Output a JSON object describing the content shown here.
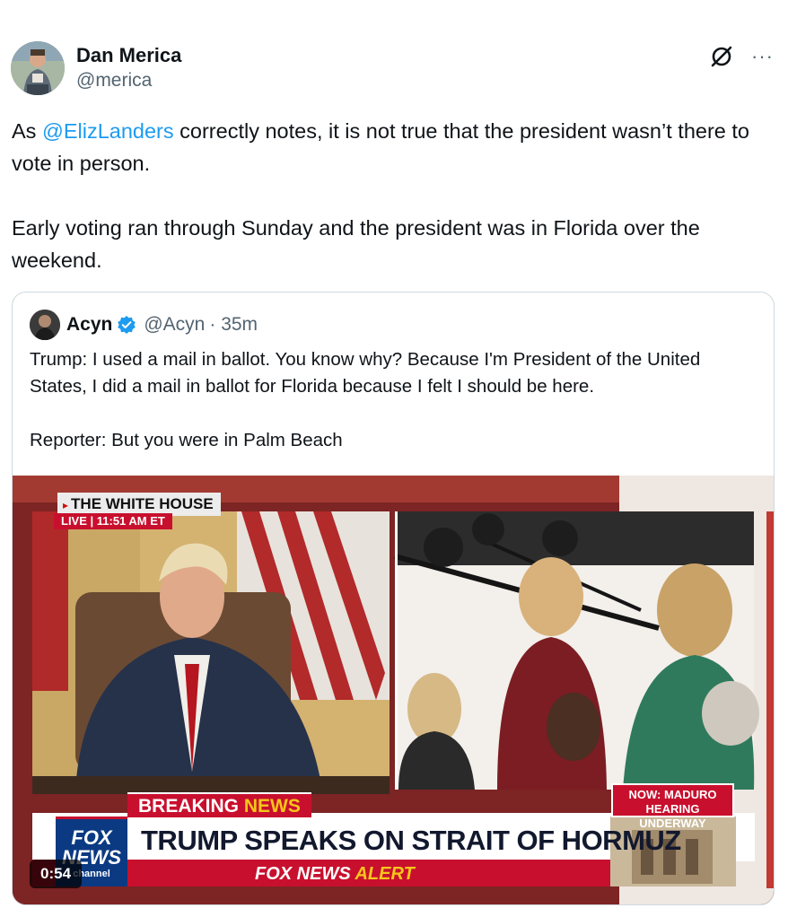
{
  "tweet": {
    "author_name": "Dan Merica",
    "author_handle": "@merica",
    "more_label": "···",
    "body_pre_mention": "As ",
    "mention": "@ElizLanders",
    "body_post_mention": " correctly notes, it is not true that the president wasn’t there to vote in person.",
    "body_second_paragraph": "Early voting ran through Sunday and the president was in Florida over the weekend."
  },
  "quote": {
    "author_name": "Acyn",
    "author_handle": "@Acyn",
    "time": "· 35m",
    "text_p1": "Trump: I used a mail in ballot. You know why? Because I'm President of the United States, I did a mail in ballot for Florida because I felt I should be here.",
    "text_p2": "Reporter: But you were in Palm Beach",
    "video": {
      "location_label": "THE WHITE HOUSE",
      "live_label": "LIVE  |  11:51 AM ET",
      "breaking_prefix": "BREAKING ",
      "breaking_accent": "NEWS",
      "side_label": "NOW: MADURO HEARING UNDERWAY",
      "headline": "TRUMP SPEAKS ON STRAIT OF HORMUZ",
      "alert_prefix": "FOX NEWS ",
      "alert_accent": "ALERT",
      "logo_text": "FOX NEWS",
      "channel_text": "channel",
      "timer": "0:54"
    }
  },
  "colors": {
    "mention": "#1d9bf0",
    "verified": "#1d9bf0",
    "fox_red": "#c8102e",
    "fox_blue": "#0b3a82",
    "news_yellow": "#f6c61b"
  },
  "icons": [
    "grok-icon",
    "more-icon",
    "verified-icon"
  ]
}
